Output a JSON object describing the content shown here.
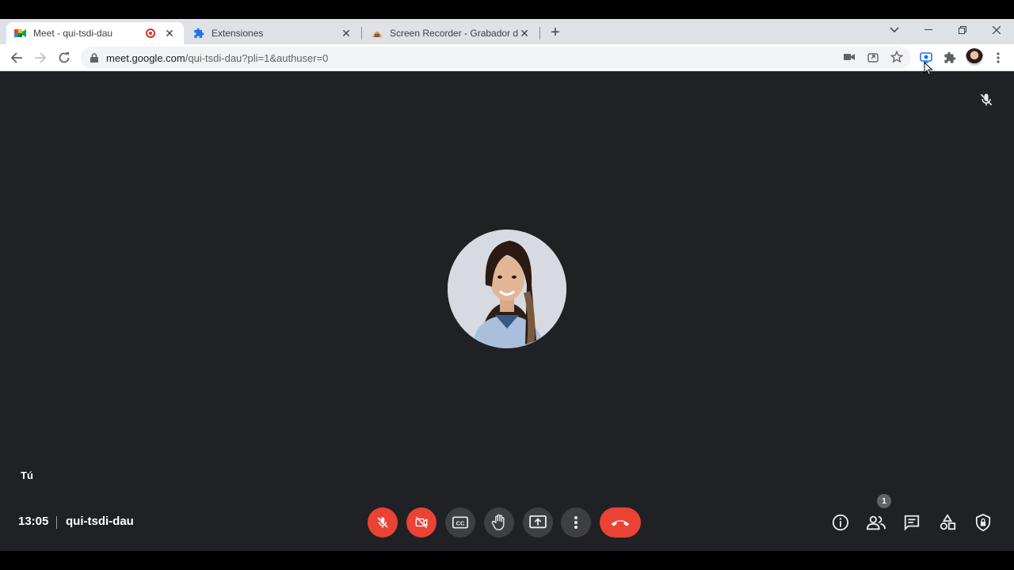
{
  "tabs": [
    {
      "title": "Meet - qui-tsdi-dau",
      "icon": "google-meet-icon",
      "recording": true
    },
    {
      "title": "Extensiones",
      "icon": "puzzle-icon"
    },
    {
      "title": "Screen Recorder - Grabador de p",
      "icon": "screen-recorder-icon"
    }
  ],
  "address": {
    "host": "meet.google.com",
    "path": "/qui-tsdi-dau?pli=1&authuser=0"
  },
  "meet": {
    "self_label": "Tú",
    "time": "13:05",
    "meeting_code": "qui-tsdi-dau",
    "participant_count": "1"
  },
  "colors": {
    "accent_red": "#ea4335",
    "control_gray": "#3c4043",
    "background": "#202124"
  }
}
